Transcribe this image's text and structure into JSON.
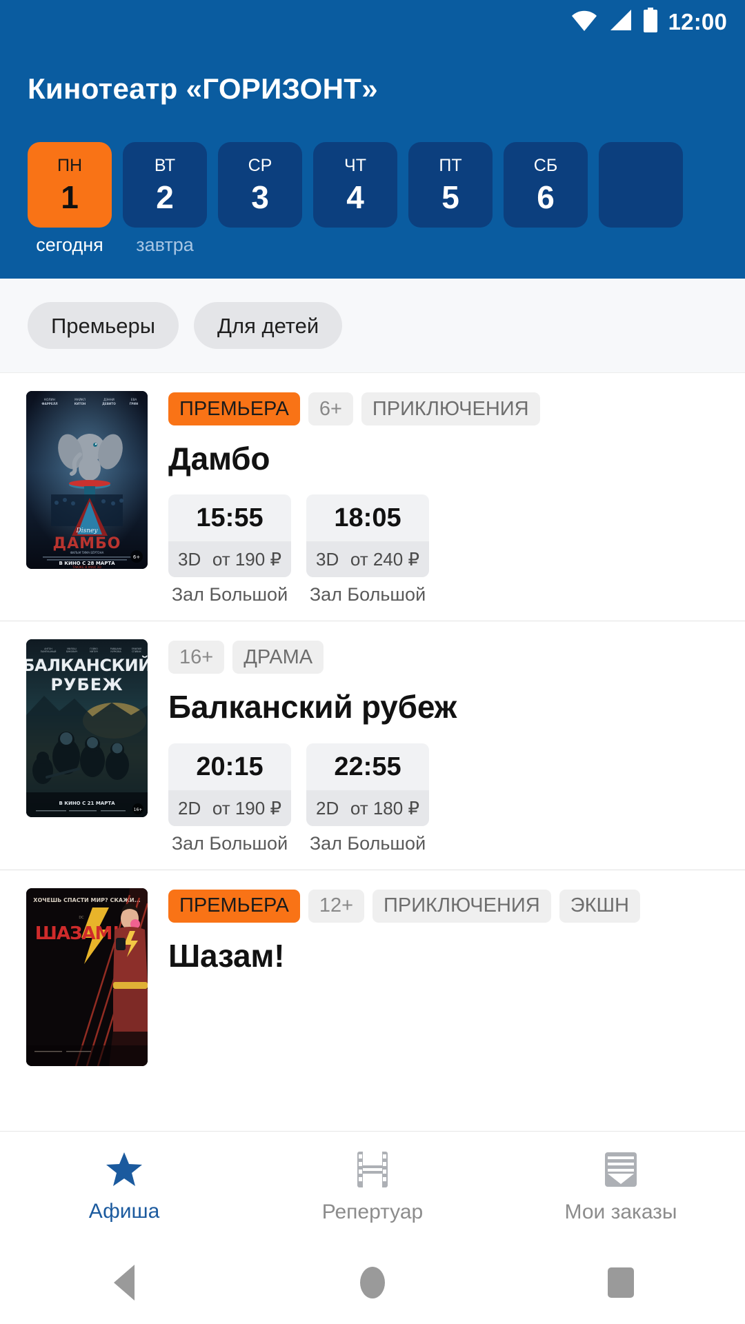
{
  "status_bar": {
    "clock": "12:00",
    "icons": [
      "wifi-icon",
      "cellular-signal-icon",
      "battery-icon"
    ]
  },
  "app_bar": {
    "title": "Кинотеатр «ГОРИЗОНТ»"
  },
  "date_strip": {
    "days": [
      {
        "dow": "ПН",
        "num": "1",
        "label": "сегодня",
        "active": true
      },
      {
        "dow": "ВТ",
        "num": "2",
        "label": "завтра",
        "active": false
      },
      {
        "dow": "СР",
        "num": "3",
        "label": "",
        "active": false
      },
      {
        "dow": "ЧТ",
        "num": "4",
        "label": "",
        "active": false
      },
      {
        "dow": "ПТ",
        "num": "5",
        "label": "",
        "active": false
      },
      {
        "dow": "СБ",
        "num": "6",
        "label": "",
        "active": false
      },
      {
        "dow": "",
        "num": "",
        "label": "",
        "active": false
      }
    ]
  },
  "filters": {
    "chips": [
      "Премьеры",
      "Для детей"
    ]
  },
  "movies": [
    {
      "poster": "dumbo-poster",
      "premiere_label": "ПРЕМЬЕРА",
      "is_premiere": true,
      "age": "6+",
      "genres": [
        "ПРИКЛЮЧЕНИЯ"
      ],
      "title": "Дамбо",
      "showtimes": [
        {
          "time": "15:55",
          "format": "3D",
          "price": "от 190 ₽",
          "hall": "Зал Большой"
        },
        {
          "time": "18:05",
          "format": "3D",
          "price": "от 240 ₽",
          "hall": "Зал Большой"
        }
      ]
    },
    {
      "poster": "balkan-poster",
      "premiere_label": "",
      "is_premiere": false,
      "age": "16+",
      "genres": [
        "ДРАМА"
      ],
      "title": "Балканский рубеж",
      "showtimes": [
        {
          "time": "20:15",
          "format": "2D",
          "price": "от 190 ₽",
          "hall": "Зал Большой"
        },
        {
          "time": "22:55",
          "format": "2D",
          "price": "от 180 ₽",
          "hall": "Зал Большой"
        }
      ]
    },
    {
      "poster": "shazam-poster",
      "premiere_label": "ПРЕМЬЕРА",
      "is_premiere": true,
      "age": "12+",
      "genres": [
        "ПРИКЛЮЧЕНИЯ",
        "ЭКШН"
      ],
      "title": "Шазам!",
      "showtimes": []
    }
  ],
  "bottom_nav": {
    "items": [
      {
        "label": "Афиша",
        "icon": "star-icon",
        "active": true
      },
      {
        "label": "Репертуар",
        "icon": "film-strip-icon",
        "active": false
      },
      {
        "label": "Мои заказы",
        "icon": "tickets-icon",
        "active": false
      }
    ]
  },
  "system_nav": {
    "buttons": [
      "back-triangle-icon",
      "home-circle-icon",
      "recents-square-icon"
    ]
  },
  "colors": {
    "header_blue": "#0a5ca0",
    "chip_blue": "#0c3f7e",
    "accent_orange": "#f97316",
    "nav_active_blue": "#1b5a9e",
    "page_bg": "#ffffff",
    "filter_bg": "#f7f8fa"
  },
  "poster_art": {
    "dumbo": {
      "title": "ДАМБО",
      "tagline": "В КИНО С 28 МАРТА",
      "studio": "Disney"
    },
    "balkan": {
      "line1": "БАЛКАНСКИЙ",
      "line2": "РУБЕЖ",
      "tagline": "В КИНО С 21 МАРТА"
    },
    "shazam": {
      "title": "ШАЗАМ!",
      "tagline": "ХОЧЕШЬ СПАСТИ МИР? СКАЖИ..."
    }
  }
}
